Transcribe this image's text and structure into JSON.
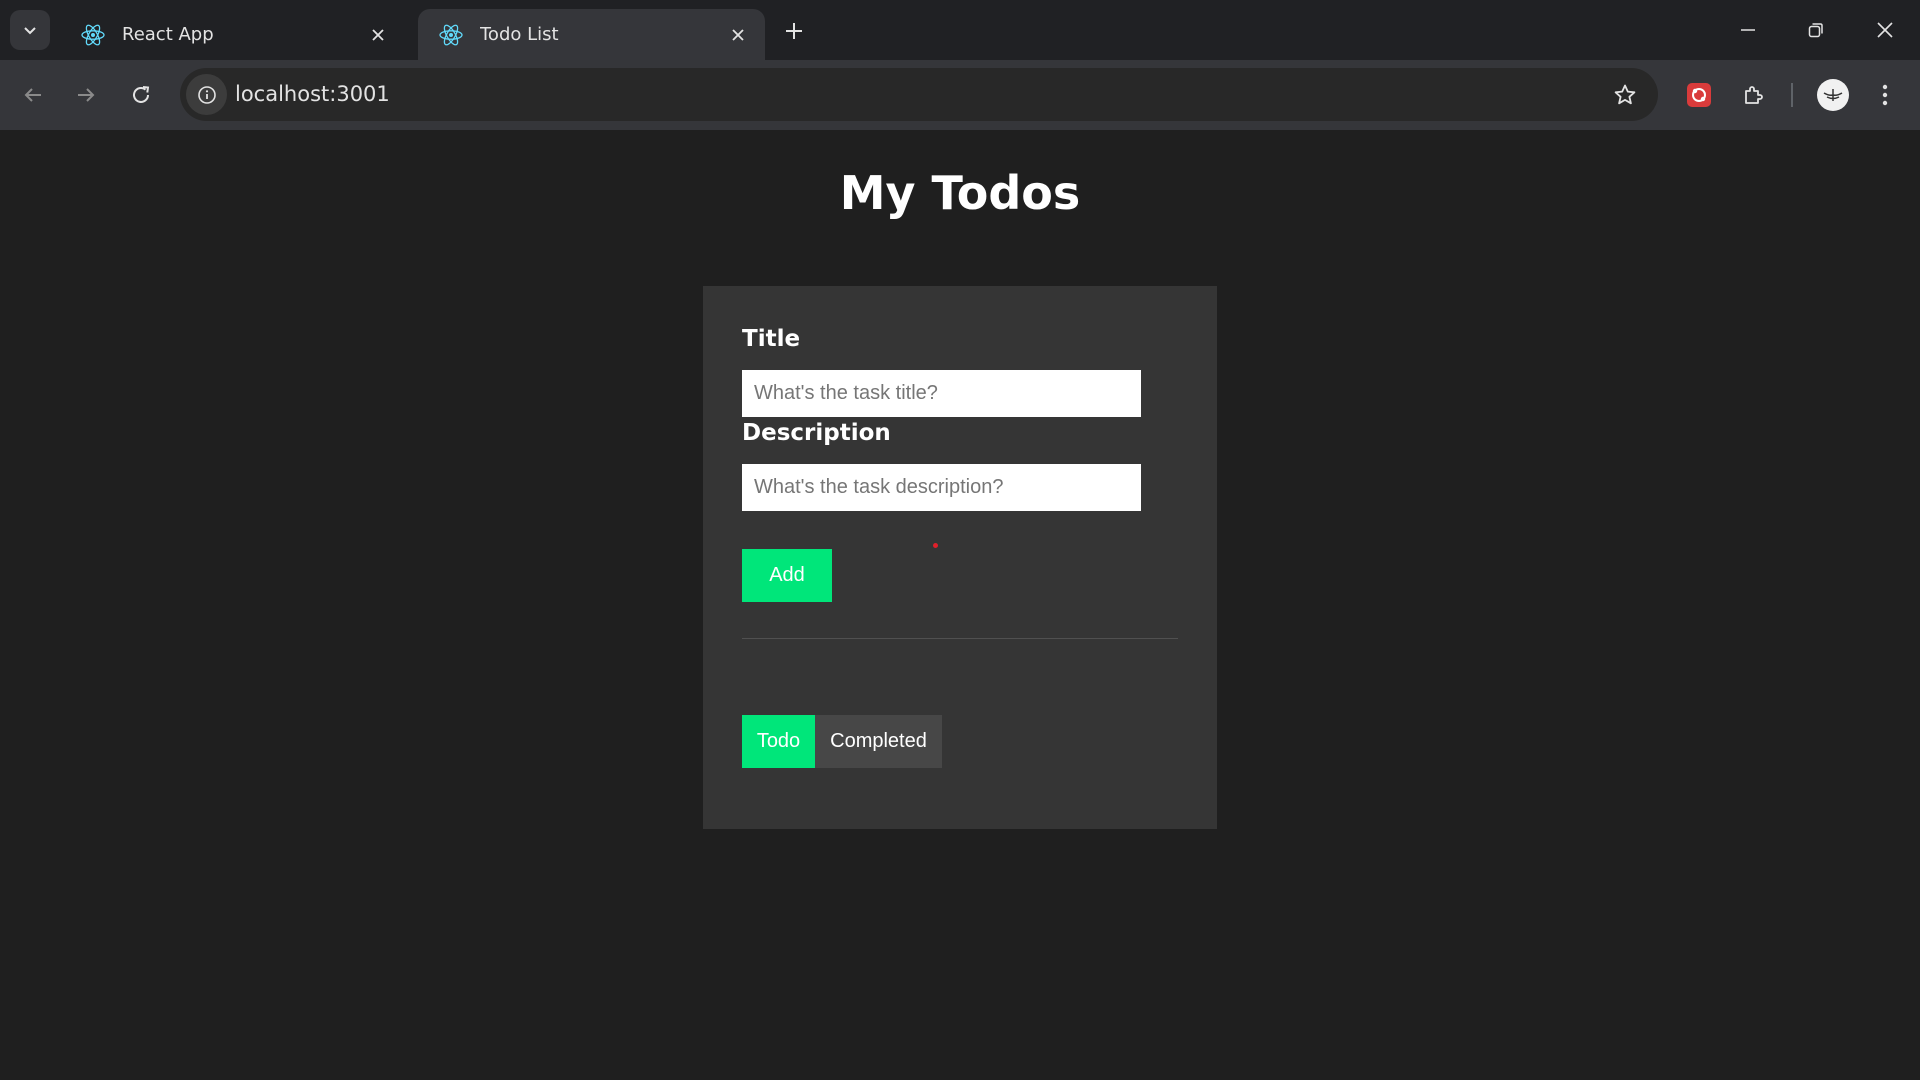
{
  "browser": {
    "tabs": [
      {
        "title": "React App",
        "active": false,
        "favicon": "react-icon"
      },
      {
        "title": "Todo List",
        "active": true,
        "favicon": "react-icon"
      }
    ],
    "url": "localhost:3001"
  },
  "app": {
    "heading": "My Todos",
    "form": {
      "title_label": "Title",
      "title_value": "",
      "title_placeholder": "What's the task title?",
      "description_label": "Description",
      "description_value": "",
      "description_placeholder": "What's the task description?",
      "add_label": "Add"
    },
    "filters": {
      "todo_label": "Todo",
      "completed_label": "Completed",
      "selected": "Todo"
    }
  },
  "colors": {
    "accent": "#00e67a",
    "page_background": "#1f1f1f",
    "card_background": "#353535",
    "inactive_tab_background": "#474747"
  }
}
